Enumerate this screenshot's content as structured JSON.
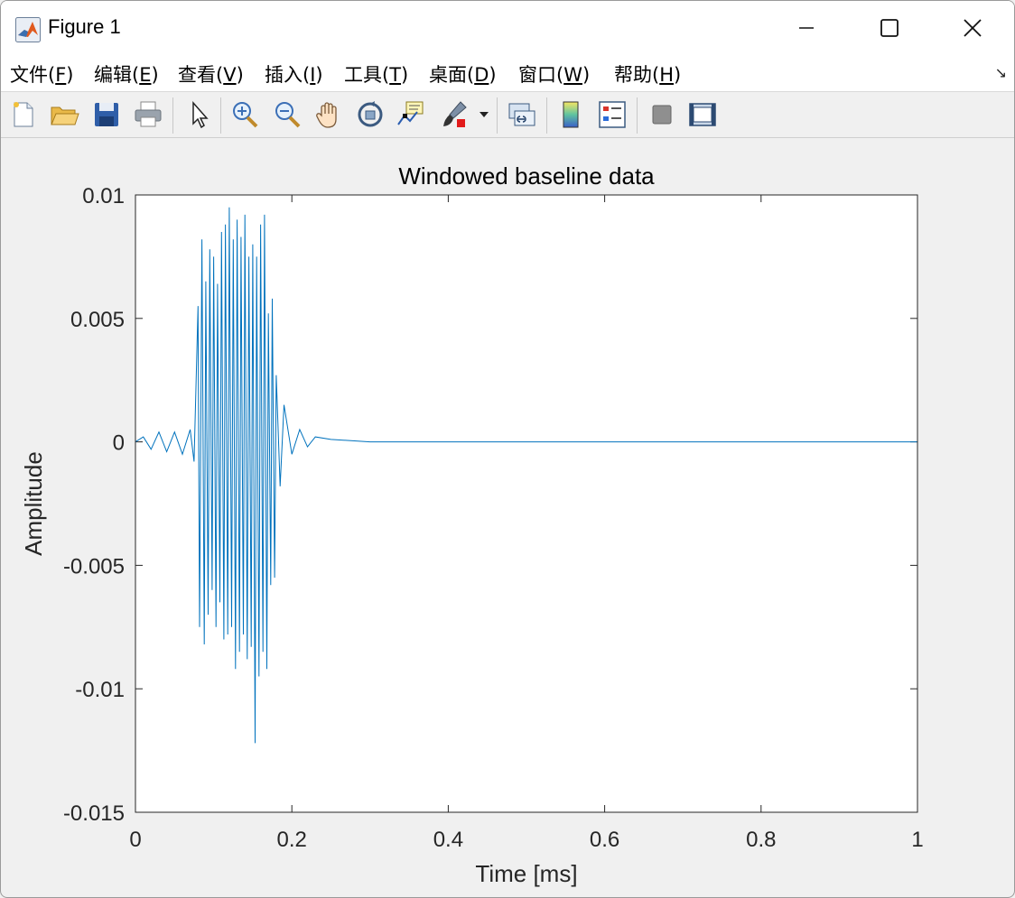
{
  "window": {
    "title": "Figure 1"
  },
  "menu": {
    "items": [
      {
        "label": "文件(",
        "key": "F",
        "close": ")"
      },
      {
        "label": "编辑(",
        "key": "E",
        "close": ")"
      },
      {
        "label": "查看(",
        "key": "V",
        "close": ")"
      },
      {
        "label": "插入(",
        "key": "I",
        "close": ")"
      },
      {
        "label": "工具(",
        "key": "T",
        "close": ")"
      },
      {
        "label": "桌面(",
        "key": "D",
        "close": ")"
      },
      {
        "label": "窗口(",
        "key": "W",
        "close": ")"
      },
      {
        "label": "帮助(",
        "key": "H",
        "close": ")"
      }
    ]
  },
  "toolbar": {
    "icons": [
      "new-figure-icon",
      "open-file-icon",
      "save-icon",
      "print-icon",
      "pointer-icon",
      "zoom-in-icon",
      "zoom-out-icon",
      "pan-icon",
      "rotate-3d-icon",
      "data-cursor-icon",
      "brush-icon",
      "link-plot-icon",
      "colorbar-icon",
      "legend-icon",
      "hide-plot-tools-icon",
      "show-plot-tools-icon"
    ]
  },
  "chart_data": {
    "type": "line",
    "title": "Windowed baseline data",
    "xlabel": "Time [ms]",
    "ylabel": "Amplitude",
    "xlim": [
      0,
      1
    ],
    "ylim": [
      -0.015,
      0.01
    ],
    "xticks": [
      "0",
      "0.2",
      "0.4",
      "0.6",
      "0.8",
      "1"
    ],
    "yticks": [
      "0.01",
      "0.005",
      "0",
      "-0.005",
      "-0.01",
      "-0.015"
    ],
    "color": "#0072BD",
    "series": [
      {
        "x": [
          0,
          0.01,
          0.02,
          0.03,
          0.04,
          0.05,
          0.06,
          0.07,
          0.075,
          0.08,
          0.082,
          0.085,
          0.088,
          0.09,
          0.093,
          0.095,
          0.098,
          0.1,
          0.103,
          0.105,
          0.108,
          0.11,
          0.113,
          0.115,
          0.118,
          0.12,
          0.123,
          0.125,
          0.128,
          0.13,
          0.133,
          0.135,
          0.138,
          0.14,
          0.143,
          0.145,
          0.148,
          0.15,
          0.153,
          0.155,
          0.158,
          0.16,
          0.163,
          0.165,
          0.168,
          0.17,
          0.173,
          0.175,
          0.178,
          0.18,
          0.185,
          0.19,
          0.2,
          0.21,
          0.22,
          0.23,
          0.25,
          0.3,
          0.5,
          0.75,
          1.0
        ],
        "y": [
          0,
          0.0002,
          -0.0003,
          0.0004,
          -0.0004,
          0.0004,
          -0.0005,
          0.0005,
          -0.0008,
          0.0055,
          -0.0075,
          0.0082,
          -0.0082,
          0.0065,
          -0.007,
          0.0078,
          -0.006,
          0.0075,
          -0.0075,
          0.0064,
          -0.0065,
          0.0085,
          -0.008,
          0.0088,
          -0.0078,
          0.0095,
          -0.0075,
          0.0082,
          -0.0092,
          0.009,
          -0.0085,
          0.0083,
          -0.0078,
          0.0092,
          -0.0088,
          0.0075,
          -0.0083,
          0.008,
          -0.0122,
          0.0075,
          -0.0095,
          0.0088,
          -0.0085,
          0.0092,
          -0.0092,
          0.0052,
          -0.0058,
          0.0058,
          -0.0055,
          0.0027,
          -0.0018,
          0.0015,
          -0.0005,
          0.0005,
          -0.0002,
          0.0002,
          0.0001,
          0,
          0,
          0,
          0
        ]
      }
    ]
  }
}
